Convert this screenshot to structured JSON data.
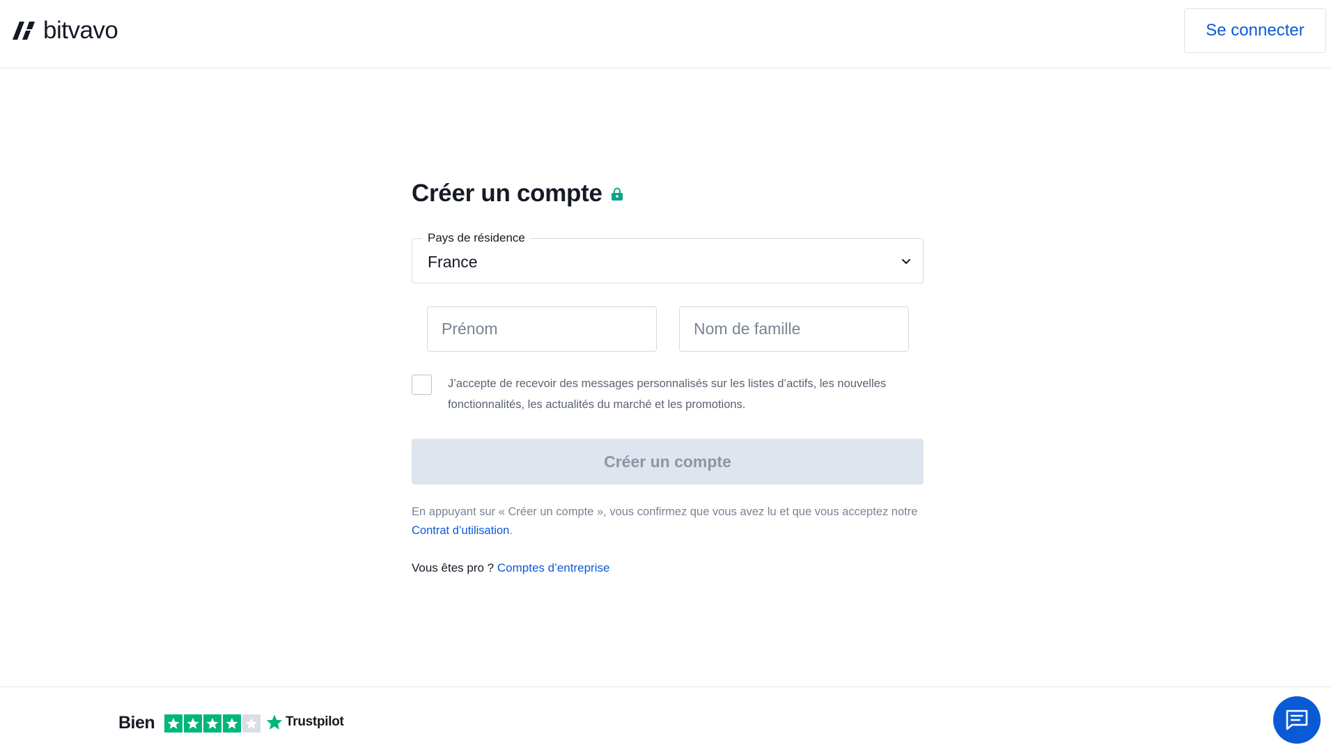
{
  "header": {
    "logo_text": "bitvavo",
    "signin_label": "Se connecter"
  },
  "form": {
    "title": "Créer un compte",
    "country": {
      "label": "Pays de résidence",
      "value": "France"
    },
    "first_name": {
      "placeholder": "Prénom",
      "value": ""
    },
    "last_name": {
      "placeholder": "Nom de famille",
      "value": ""
    },
    "consent": {
      "checked": false,
      "text": "J’accepte de recevoir des messages personnalisés sur les listes d’actifs, les nouvelles fonctionnalités, les actualités du marché et les promotions."
    },
    "submit_label": "Créer un compte",
    "terms": {
      "prefix": "En appuyant sur « Créer un compte », vous confirmez que vous avez lu et que vous acceptez notre ",
      "link_label": "Contrat d’utilisation",
      "suffix": "."
    },
    "pro": {
      "prefix": "Vous êtes pro ? ",
      "link_label": "Comptes d’entreprise"
    }
  },
  "footer": {
    "rating_text": "Bien",
    "stars": 4,
    "stars_total": 5,
    "brand": "Trustpilot"
  },
  "colors": {
    "accent": "#0a5ad6",
    "lock": "#0aa58a",
    "trustpilot_green": "#00b67a",
    "button_disabled": "#dfe5ee"
  },
  "icons": {
    "logo": "bitvavo-logo-icon",
    "lock": "lock-icon",
    "chevron": "chevron-down-icon",
    "star": "star-icon",
    "chat": "chat-icon"
  }
}
